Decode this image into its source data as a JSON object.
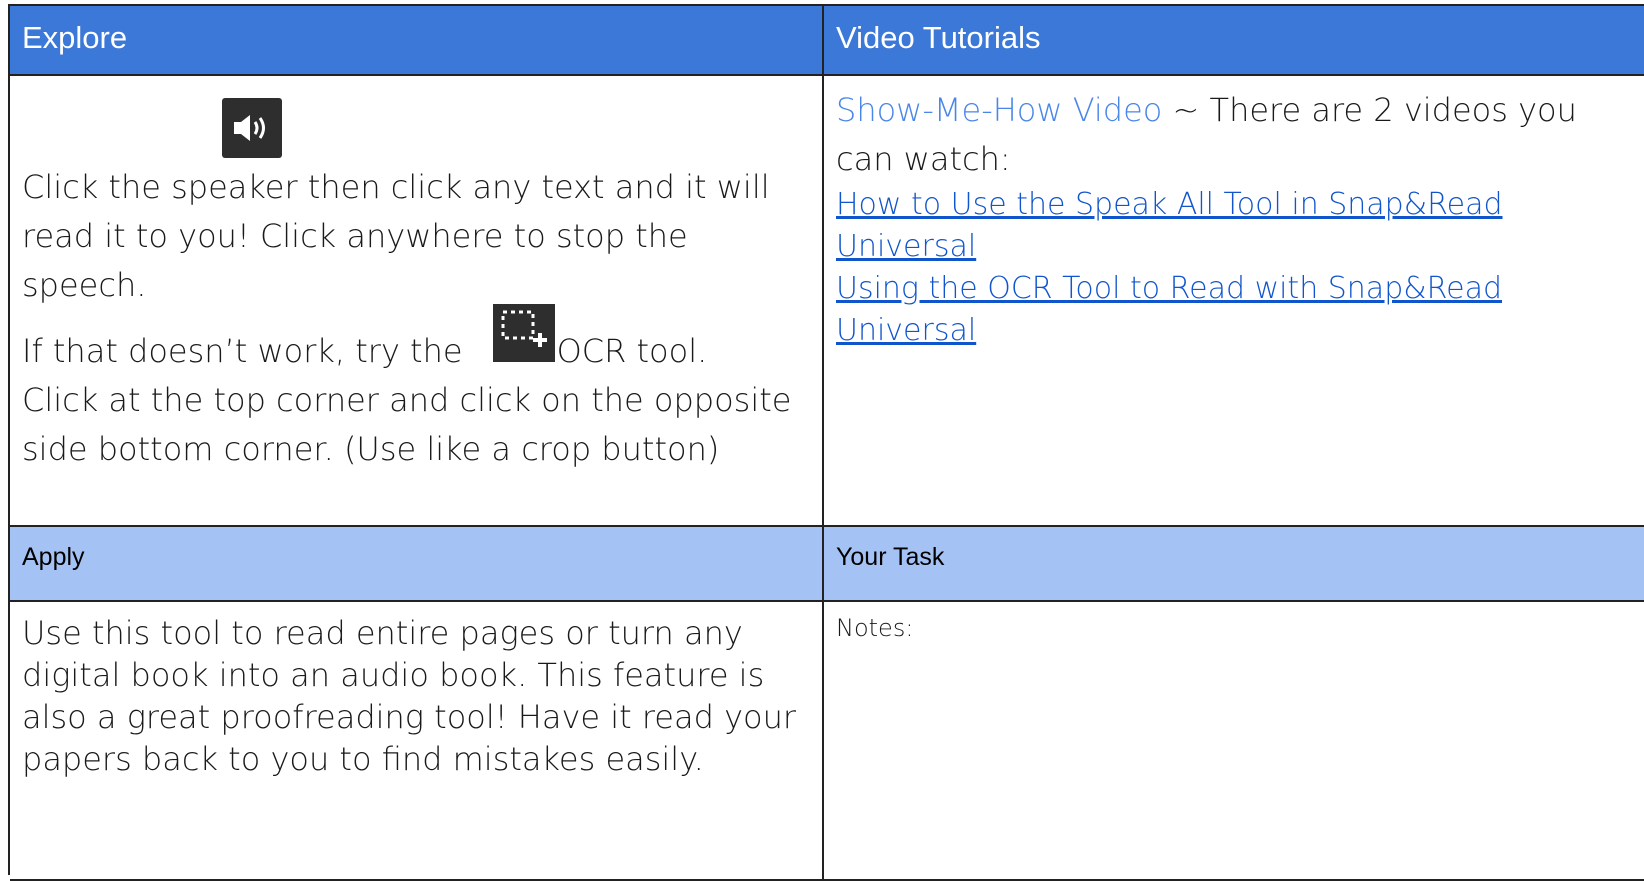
{
  "explore": {
    "heading": "Explore",
    "line1": "Click the speaker then click any text and it will read it to you!  Click anywhere to stop the speech.",
    "line2_before": "If that doesn’t work, try the",
    "line2_after": "OCR tool.",
    "line3": "Click at the top corner and click on the opposite side bottom corner. (Use like a crop button)",
    "speaker_icon": "speaker-icon",
    "ocr_icon": "ocr-crop-icon"
  },
  "video": {
    "heading": "Video Tutorials",
    "title_link": "Show-Me-How Video",
    "intro": " ~ There are 2 videos you can watch:",
    "links": [
      "How to Use the Speak All Tool in Snap&Read Universal",
      "Using the OCR Tool to Read with Snap&Read Universal"
    ]
  },
  "apply": {
    "heading": "Apply",
    "body": "Use this tool to read entire pages or turn any digital book into an audio book. This feature is also a great proofreading tool! Have it read your papers back to you to find mistakes easily."
  },
  "task": {
    "heading": "Your Task",
    "notes_label": "Notes:"
  },
  "colors": {
    "header_dark": "#3c78d8",
    "header_light": "#a4c2f4",
    "link": "#1155cc",
    "link_light": "#4a86e8"
  }
}
